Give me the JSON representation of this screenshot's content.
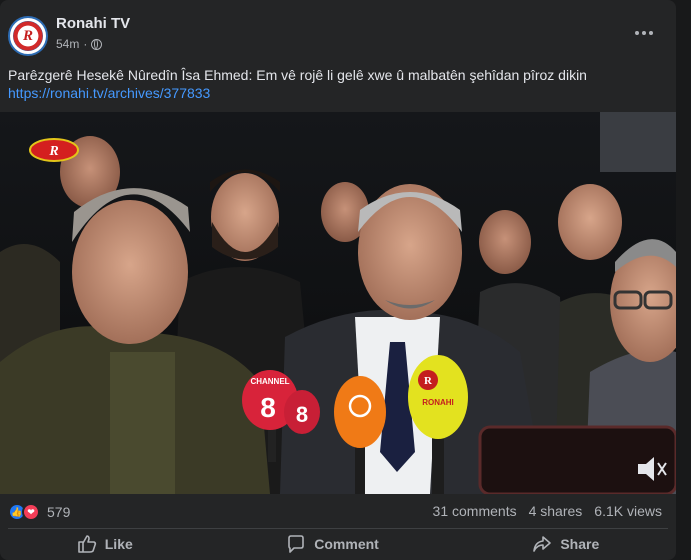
{
  "post": {
    "page_name": "Ronahi TV",
    "avatar_letter": "R",
    "time": "54m",
    "separator": "·",
    "privacy_icon": "globe-icon",
    "more_icon": "more-dots-icon",
    "caption_text": "Parêzgerê Hesekê Nûredîn Îsa Ehmed: Em vê rojê li gelê xwe û malbatên şehîdan pîroz dikin",
    "caption_link": "https://ronahi.tv/archives/377833"
  },
  "video": {
    "channel_logo": "R",
    "mic_left": "CHANNEL 8",
    "mic_left_digit": "8",
    "mic_yellow_logo": "R",
    "mic_yellow_text": "RONAHI",
    "mute_icon": "speaker-muted-icon",
    "colors": {
      "mic_orange": "#f07a16",
      "mic_yellow": "#e3e21f",
      "mic_red": "#d8233a"
    }
  },
  "engagement": {
    "reaction_icons": [
      "like-reaction-icon",
      "love-reaction-icon"
    ],
    "reaction_count": "579",
    "comments": "31 comments",
    "shares": "4 shares",
    "views": "6.1K views"
  },
  "actions": {
    "like": "Like",
    "comment": "Comment",
    "share": "Share"
  },
  "colors": {
    "background": "#18191a",
    "card": "#242526",
    "link": "#4599ff",
    "like_blue": "#2078f4",
    "love_red": "#f33e58"
  }
}
